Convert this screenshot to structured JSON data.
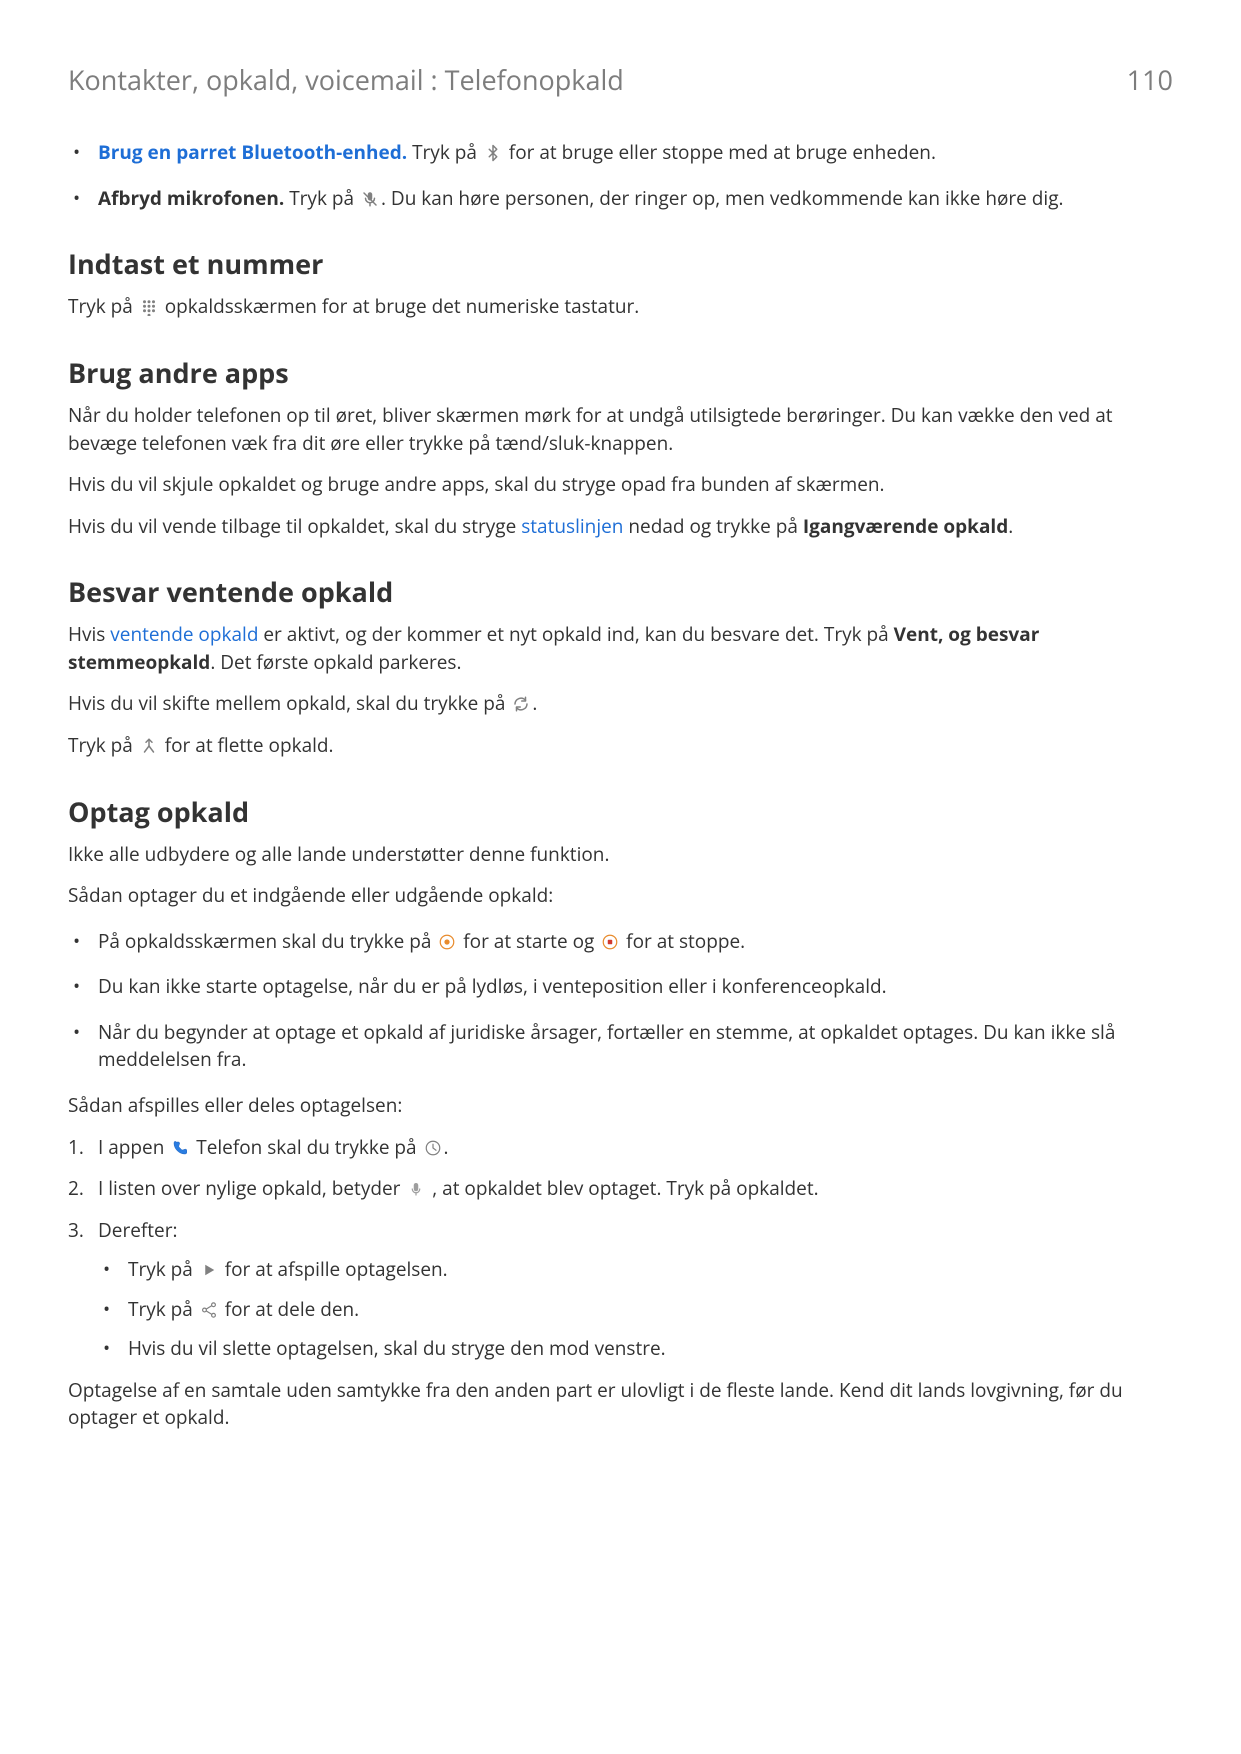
{
  "header": {
    "breadcrumb": "Kontakter, opkald, voicemail : Telefonopkald",
    "page_number": "110"
  },
  "top_bullets": [
    {
      "link": "Brug en parret Bluetooth-enhed.",
      "pre": " Tryk på ",
      "post": " for at bruge eller stoppe med at bruge enheden.",
      "icon": "bluetooth"
    },
    {
      "bold": "Afbryd mikrofonen.",
      "pre": " Tryk på ",
      "post": ". Du kan høre personen, der ringer op, men vedkommende kan ikke høre dig.",
      "icon": "mic-off"
    }
  ],
  "s1": {
    "heading": "Indtast et nummer",
    "p1_pre": "Tryk på ",
    "p1_post": " opkaldsskærmen for at bruge det numeriske tastatur."
  },
  "s2": {
    "heading": "Brug andre apps",
    "p1": "Når du holder telefonen op til øret, bliver skærmen mørk for at undgå utilsigtede berøringer. Du kan vække den ved at bevæge telefonen væk fra dit øre eller trykke på tænd/sluk-knappen.",
    "p2": "Hvis du vil skjule opkaldet og bruge andre apps, skal du stryge opad fra bunden af skærmen.",
    "p3_pre": "Hvis du vil vende tilbage til opkaldet, skal du stryge ",
    "p3_link": "statuslinjen",
    "p3_mid": " nedad og trykke på ",
    "p3_bold": "Igangværende opkald",
    "p3_end": "."
  },
  "s3": {
    "heading": "Besvar ventende opkald",
    "p1_pre": "Hvis ",
    "p1_link": "ventende opkald",
    "p1_mid": " er aktivt, og der kommer et nyt opkald ind, kan du besvare det. Tryk på ",
    "p1_bold": "Vent, og besvar stemmeopkald",
    "p1_end": ". Det første opkald parkeres.",
    "p2_pre": "Hvis du vil skifte mellem opkald, skal du trykke på ",
    "p2_post": ".",
    "p3_pre": "Tryk på ",
    "p3_post": " for at flette opkald."
  },
  "s4": {
    "heading": "Optag opkald",
    "p1": "Ikke alle udbydere og alle lande understøtter denne funktion.",
    "p2": "Sådan optager du et indgående eller udgående opkald:",
    "b1_pre": "På opkaldsskærmen skal du trykke på ",
    "b1_mid": " for at starte og ",
    "b1_post": " for at stoppe.",
    "b2": "Du kan ikke starte optagelse, når du er på lydløs, i venteposition eller i konferenceopkald.",
    "b3": "Når du begynder at optage et opkald af juridiske årsager, fortæller en stemme, at opkaldet optages. Du kan ikke slå meddelelsen fra.",
    "p3": "Sådan afspilles eller deles optagelsen:",
    "ol1_pre": "I appen ",
    "ol1_mid": " Telefon skal du trykke på ",
    "ol1_post": ".",
    "ol2_pre": "I listen over nylige opkald, betyder ",
    "ol2_post": " , at opkaldet blev optaget. Tryk på opkaldet.",
    "ol3": "Derefter:",
    "ol3_b1_pre": "Tryk på ",
    "ol3_b1_post": " for at afspille optagelsen.",
    "ol3_b2_pre": "Tryk på ",
    "ol3_b2_post": " for at dele den.",
    "ol3_b3": "Hvis du vil slette optagelsen, skal du stryge den mod venstre.",
    "p4": "Optagelse af en samtale uden samtykke fra den anden part er ulovligt i de fleste lande. Kend dit lands lovgivning, før du optager et opkald."
  }
}
